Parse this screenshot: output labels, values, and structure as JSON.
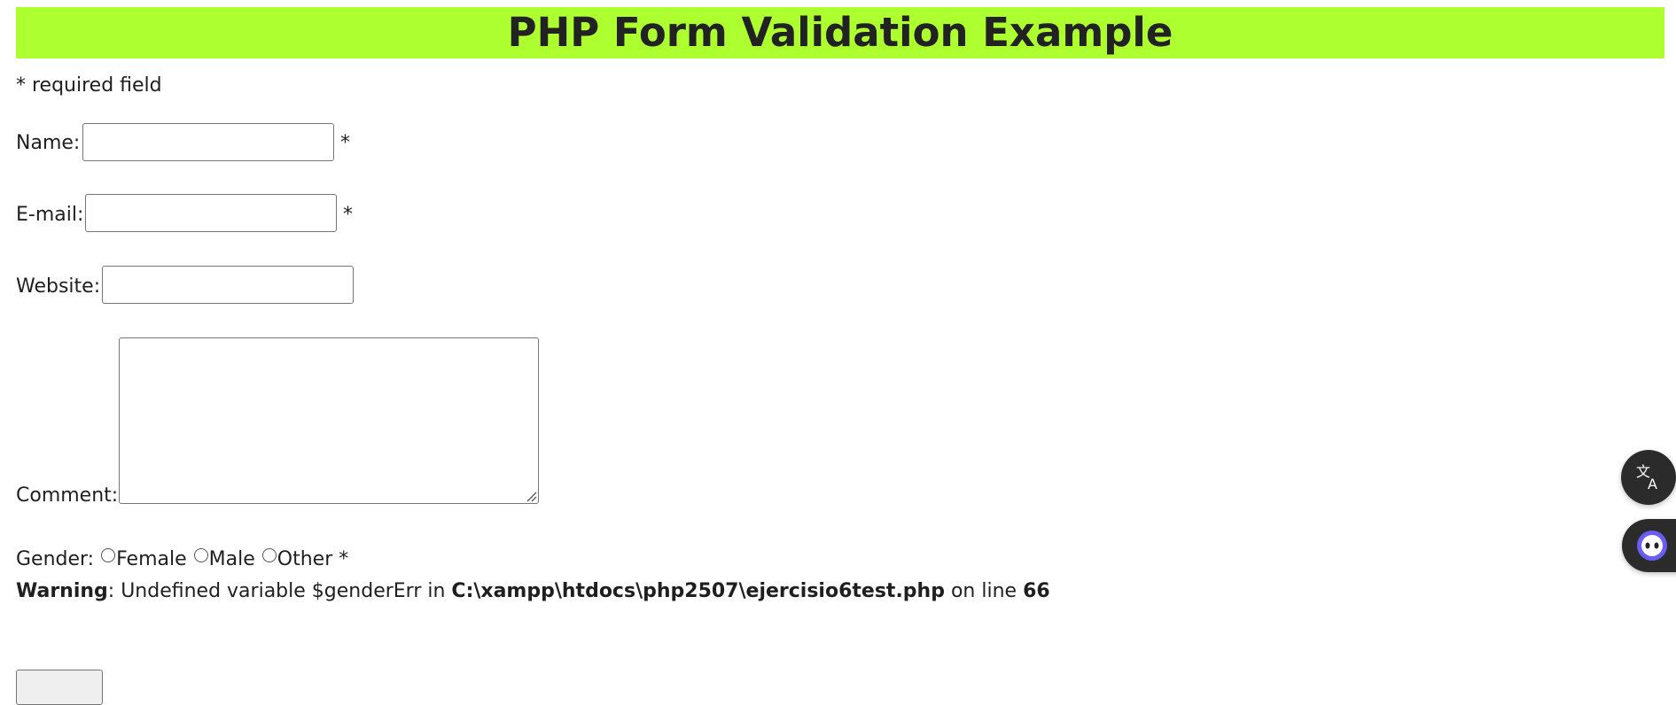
{
  "header": {
    "title": "PHP Form Validation Example"
  },
  "required_note": "* required field",
  "form": {
    "name": {
      "label": "Name:",
      "value": "",
      "required_mark": "*"
    },
    "email": {
      "label": "E-mail:",
      "value": "",
      "required_mark": "*"
    },
    "website": {
      "label": "Website:",
      "value": ""
    },
    "comment": {
      "label": "Comment:",
      "value": ""
    },
    "gender": {
      "label": "Gender:",
      "options": [
        "Female",
        "Male",
        "Other"
      ],
      "required_mark": "*"
    }
  },
  "warning": {
    "label": "Warning",
    "message": ": Undefined variable $genderErr in ",
    "file": "C:\\xampp\\htdocs\\php2507\\ejercisio6test.php",
    "on_line": " on line ",
    "line": "66"
  },
  "floating": {
    "translate_icon": "translate-icon",
    "assistant_icon": "assistant-icon"
  },
  "colors": {
    "header_bg": "#adff2f"
  }
}
